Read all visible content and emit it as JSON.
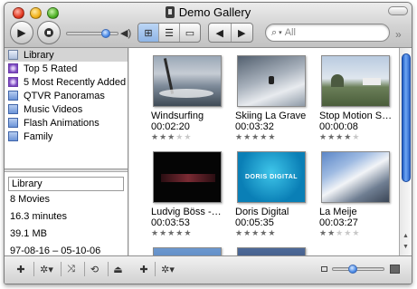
{
  "window": {
    "title": "Demo Gallery"
  },
  "toolbar": {
    "play_icon": "play-icon",
    "stop_icon": "stop-icon",
    "volume_icon": "speaker-icon",
    "volume_level": 0.75,
    "view_modes": [
      "grid-view-icon",
      "list-view-icon",
      "single-view-icon"
    ],
    "selected_view": 0,
    "nav": [
      "back-arrow-icon",
      "forward-arrow-icon"
    ],
    "search": {
      "placeholder": "All"
    },
    "overflow_glyph": "»"
  },
  "sources": [
    {
      "label": "Library",
      "icon": "library-icon",
      "selected": true
    },
    {
      "label": "Top 5 Rated",
      "icon": "smart-collection-icon",
      "selected": false
    },
    {
      "label": "5 Most Recently Added",
      "icon": "smart-collection-icon",
      "selected": false
    },
    {
      "label": "QTVR Panoramas",
      "icon": "collection-icon",
      "selected": false
    },
    {
      "label": "Music Videos",
      "icon": "collection-icon",
      "selected": false
    },
    {
      "label": "Flash Animations",
      "icon": "collection-icon",
      "selected": false
    },
    {
      "label": "Family",
      "icon": "collection-icon",
      "selected": false
    }
  ],
  "info": {
    "name": "Library",
    "movies": "8 Movies",
    "duration": "16.3 minutes",
    "size": "39.1 MB",
    "date_range": "97-08-16 – 05-10-06"
  },
  "items": [
    {
      "name": "Windsurfing",
      "duration": "00:02:20",
      "rating": 3
    },
    {
      "name": "Skiing La Grave",
      "duration": "00:03:32",
      "rating": 5
    },
    {
      "name": "Stop Motion S…",
      "duration": "00:00:08",
      "rating": 4
    },
    {
      "name": "Ludvig Böss -…",
      "duration": "00:03:53",
      "rating": 5
    },
    {
      "name": "Doris Digital",
      "duration": "00:05:35",
      "rating": 5
    },
    {
      "name": "La Meije",
      "duration": "00:03:27",
      "rating": 2
    }
  ],
  "thumb_text": {
    "doris": "DORIS DIGITAL"
  },
  "bottom_left": [
    "add-icon",
    "gear-icon",
    "shuffle-icon",
    "repeat-icon",
    "eject-icon"
  ],
  "bottom_right": [
    "add-icon",
    "gear-icon"
  ],
  "zoom_level": 0.4
}
